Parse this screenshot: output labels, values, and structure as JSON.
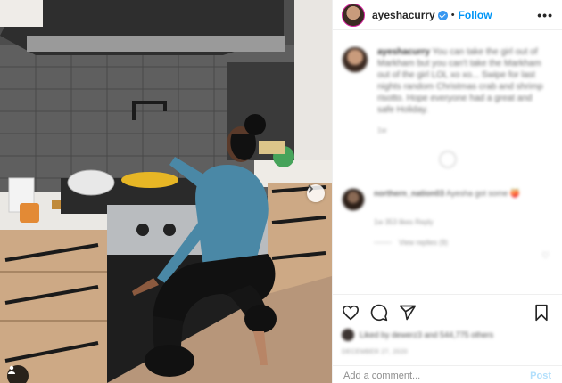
{
  "post": {
    "username": "ayeshacurry",
    "follow_label": "Follow",
    "separator": "•",
    "more_label": "•••"
  },
  "caption": {
    "username": "ayeshacurry",
    "text": "You can take the girl out of Markham but you can't take the Markham out of the girl LOL xo xo... Swipe for last nights random Christmas crab and shrimp risotto. Hope everyone had a great and safe Holiday.",
    "meta": "1w"
  },
  "reply": {
    "username": "northern_nation03",
    "text": "Ayesha got some 🍑",
    "meta": "1w   353 likes   Reply",
    "view_replies": "View replies (9)"
  },
  "likes": {
    "text": "Liked by dewerz3 and 544,775 others"
  },
  "date": "DECEMBER 27, 2020",
  "comment_box": {
    "placeholder": "Add a comment...",
    "post_label": "Post"
  },
  "icons": {
    "like": "heart-icon",
    "comment": "comment-icon",
    "share": "share-icon",
    "save": "bookmark-icon",
    "more": "more-icon",
    "next": "chevron-right-icon",
    "tag": "user-tag-icon"
  },
  "colors": {
    "follow": "#0095f6",
    "verified": "#3897f0",
    "post_disabled": "#b2dffc"
  }
}
